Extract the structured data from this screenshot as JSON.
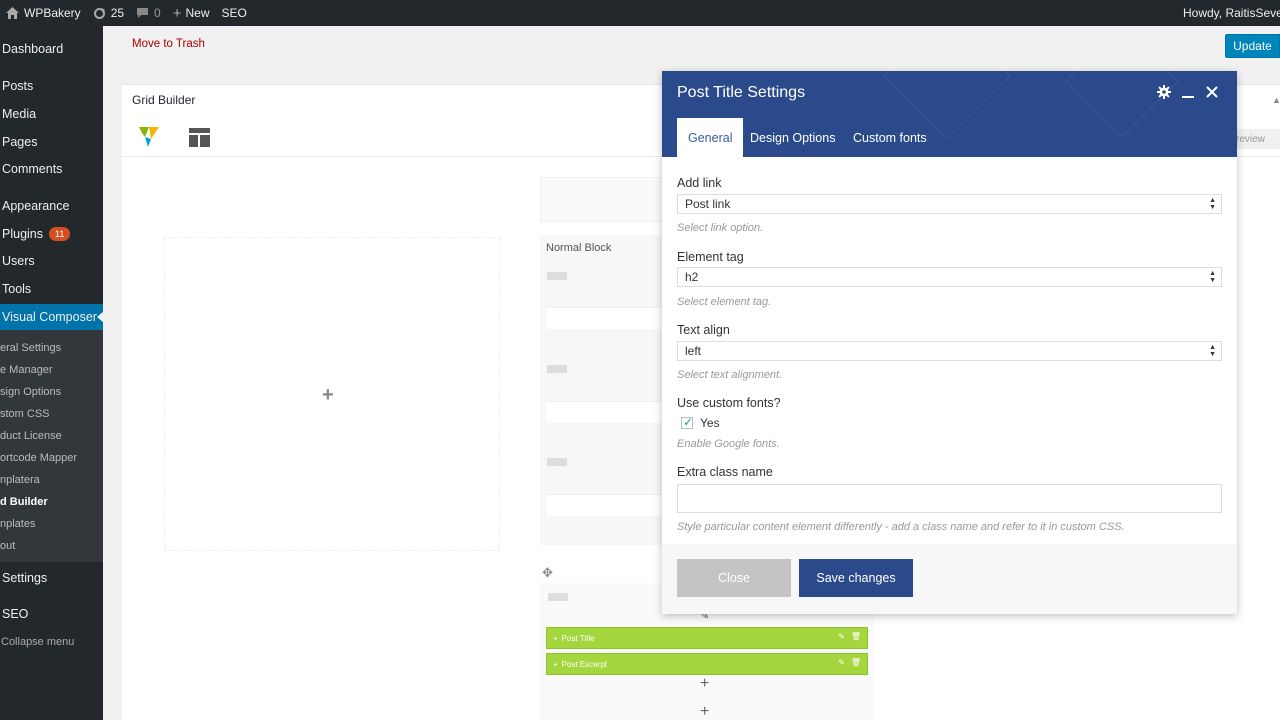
{
  "adminbar": {
    "site_name": "WPBakery",
    "updates_count": "25",
    "comments_count": "0",
    "new_label": "New",
    "seo_label": "SEO",
    "howdy": "Howdy, RaitisSevelis"
  },
  "sidebar": {
    "items": [
      {
        "label": "Dashboard"
      },
      {
        "label": "Posts"
      },
      {
        "label": "Media"
      },
      {
        "label": "Pages"
      },
      {
        "label": "Comments"
      },
      {
        "label": "Appearance"
      },
      {
        "label": "Plugins",
        "badge": "11"
      },
      {
        "label": "Users"
      },
      {
        "label": "Tools"
      },
      {
        "label": "Visual Composer"
      },
      {
        "label": "Settings"
      },
      {
        "label": "SEO"
      }
    ],
    "submenu": [
      {
        "label": "eral Settings"
      },
      {
        "label": "e Manager"
      },
      {
        "label": "sign Options"
      },
      {
        "label": "stom CSS"
      },
      {
        "label": "duct License"
      },
      {
        "label": "ortcode Mapper"
      },
      {
        "label": "nplatera"
      },
      {
        "label": "d Builder"
      },
      {
        "label": "nplates"
      },
      {
        "label": "out"
      }
    ],
    "collapse_label": "Collapse menu"
  },
  "toolbar": {
    "trash_label": "Move to Trash",
    "update_label": "Update"
  },
  "grid": {
    "title": "Grid Builder",
    "preview_label": "review",
    "normal_block_label": "Normal Block",
    "rows": [
      {
        "label": "Post Title"
      },
      {
        "label": "Post Excerpt"
      }
    ]
  },
  "modal": {
    "title": "Post Title Settings",
    "tabs": [
      {
        "label": "General"
      },
      {
        "label": "Design Options"
      },
      {
        "label": "Custom fonts"
      }
    ],
    "fields": {
      "add_link": {
        "label": "Add link",
        "value": "Post link",
        "help": "Select link option."
      },
      "element_tag": {
        "label": "Element tag",
        "value": "h2",
        "help": "Select element tag."
      },
      "text_align": {
        "label": "Text align",
        "value": "left",
        "help": "Select text alignment."
      },
      "custom_fonts": {
        "label": "Use custom fonts?",
        "checkbox_label": "Yes",
        "help": "Enable Google fonts."
      },
      "extra_class": {
        "label": "Extra class name",
        "value": "",
        "help": "Style particular content element differently - add a class name and refer to it in custom CSS."
      }
    },
    "close_label": "Close",
    "save_label": "Save changes"
  },
  "colors": {
    "adminbar_bg": "#23282d",
    "active_menu": "#0073aa",
    "modal_header": "#2b4a8b",
    "green_row": "#a4d63d",
    "trash_link": "#a00"
  }
}
